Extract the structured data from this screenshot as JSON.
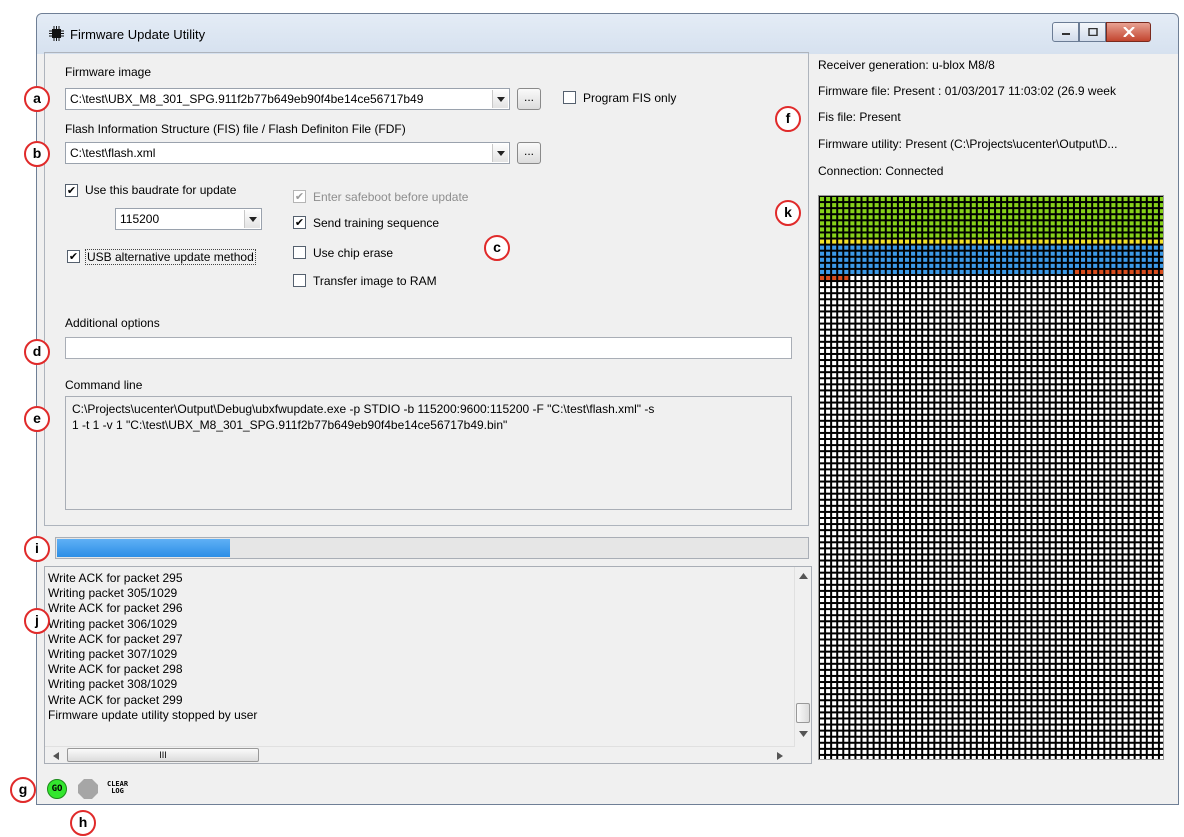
{
  "window": {
    "title": "Firmware Update Utility"
  },
  "firmware": {
    "label": "Firmware image",
    "path": "C:\\test\\UBX_M8_301_SPG.911f2b77b649eb90f4be14ce56717b49",
    "browse_label": "...",
    "program_fis_only_label": "Program FIS only",
    "program_fis_only_checked": false
  },
  "fis": {
    "label": "Flash Information Structure (FIS) file / Flash Definiton File (FDF)",
    "path": "C:\\test\\flash.xml",
    "browse_label": "..."
  },
  "options": {
    "use_baudrate_label": "Use this baudrate for update",
    "use_baudrate_checked": true,
    "baudrate": "115200",
    "usb_alt_label": "USB alternative update method",
    "usb_alt_checked": true,
    "safeboot_label": "Enter safeboot before update",
    "safeboot_checked": true,
    "safeboot_disabled": true,
    "training_label": "Send training sequence",
    "training_checked": true,
    "chip_erase_label": "Use chip erase",
    "chip_erase_checked": false,
    "ram_label": "Transfer image to RAM",
    "ram_checked": false
  },
  "additional": {
    "label": "Additional options",
    "value": ""
  },
  "command": {
    "label": "Command line",
    "line1": "C:\\Projects\\ucenter\\Output\\Debug\\ubxfwupdate.exe -p STDIO -b 115200:9600:115200 -F \"C:\\test\\flash.xml\" -s",
    "line2": "1 -t 1 -v 1 \"C:\\test\\UBX_M8_301_SPG.911f2b77b649eb90f4be14ce56717b49.bin\""
  },
  "progress": {
    "fraction": 0.23
  },
  "log": [
    "Write ACK for packet 295",
    "Writing packet 305/1029",
    "Write ACK for packet 296",
    "Writing packet 306/1029",
    "Write ACK for packet 297",
    "Writing packet 307/1029",
    "Write ACK for packet 298",
    "Writing packet 308/1029",
    "Write ACK for packet 299",
    "Firmware update utility stopped by user"
  ],
  "hscroll_label": "III",
  "info": {
    "receiver": "Receiver generation: u-blox M8/8",
    "firmware_file": "Firmware file: Present : 01/03/2017  11:03:02 (26.9 week",
    "fis_file": "Fis file: Present",
    "utility": "Firmware utility: Present (C:\\Projects\\ucenter\\Output\\D...",
    "connection": "Connection: Connected"
  },
  "status": {
    "go_label": "GO",
    "clear_log_label": "CLEAR\nLOG"
  },
  "annotations": [
    "a",
    "b",
    "c",
    "d",
    "e",
    "f",
    "g",
    "h",
    "i",
    "j",
    "k"
  ],
  "colors": {
    "grid_green": "#86d21a",
    "grid_yellow": "#f2e12a",
    "grid_blue": "#3c9ae8",
    "grid_red": "#d94d1e",
    "grid_white": "#ffffff",
    "grid_line": "#000000",
    "go_green": "#33e62e",
    "stop_gray": "#a6a6a6",
    "annot_red": "#e02a2a"
  },
  "flash_map": {
    "columns": 57,
    "rows": 93,
    "green_rows": 7,
    "yellow_cells_in_row_8": 57,
    "blue_full_rows": 4,
    "blue_partial_row_cells": 42,
    "red_partial_row_cells": 15,
    "red_next_row_cells": 5
  }
}
